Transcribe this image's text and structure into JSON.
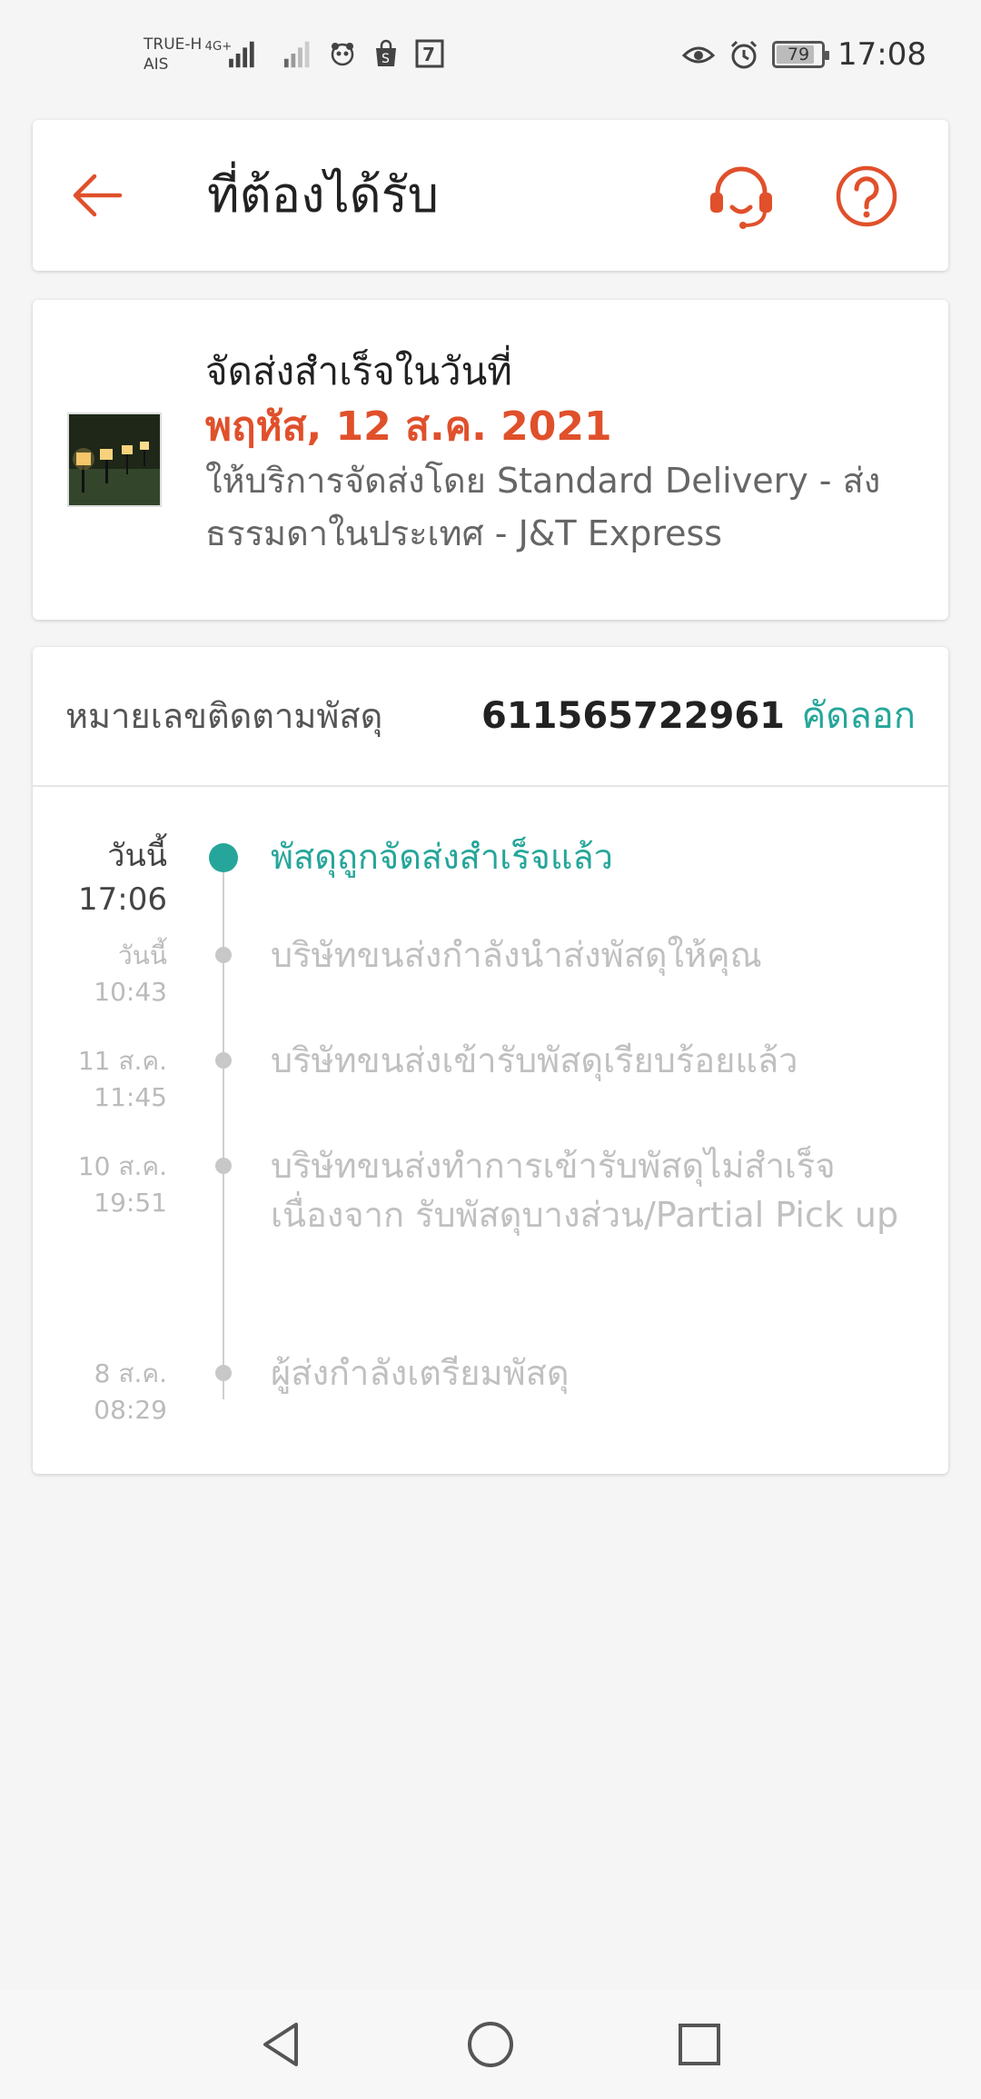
{
  "status_bar": {
    "carrier1": "TRUE-H",
    "carrier2": "AIS",
    "network": "4G+",
    "battery": "79",
    "time": "17:08"
  },
  "header": {
    "title": "ที่ต้องได้รับ"
  },
  "delivery": {
    "title": "จัดส่งสำเร็จในวันที่",
    "date": "พฤหัส, 12 ส.ค. 2021",
    "description": "ให้บริการจัดส่งโดย Standard Delivery - ส่งธรรมดาในประเทศ - J&T Express"
  },
  "tracking": {
    "label": "หมายเลขติดตามพัสดุ",
    "number": "611565722961",
    "copy_label": "คัดลอก"
  },
  "timeline": [
    {
      "date": "วันนี้",
      "time": "17:06",
      "text": "พัสดุถูกจัดส่งสำเร็จแล้ว",
      "active": true
    },
    {
      "date": "วันนี้",
      "time": "10:43",
      "text": "บริษัทขนส่งกำลังนำส่งพัสดุให้คุณ",
      "active": false
    },
    {
      "date": "11 ส.ค.",
      "time": "11:45",
      "text": "บริษัทขนส่งเข้ารับพัสดุเรียบร้อยแล้ว",
      "active": false
    },
    {
      "date": "10 ส.ค.",
      "time": "19:51",
      "text": "บริษัทขนส่งทำการเข้ารับพัสดุไม่สำเร็จ เนื่องจาก รับพัสดุบางส่วน/Partial Pick up",
      "active": false
    },
    {
      "date": "8 ส.ค.",
      "time": "08:29",
      "text": "ผู้ส่งกำลังเตรียมพัสดุ",
      "active": false
    }
  ],
  "colors": {
    "accent": "#e0502b",
    "success": "#26a69a",
    "muted": "#c0c0c0"
  },
  "icons": {
    "back": "arrow-left-icon",
    "support": "headset-icon",
    "help": "question-circle-icon"
  }
}
